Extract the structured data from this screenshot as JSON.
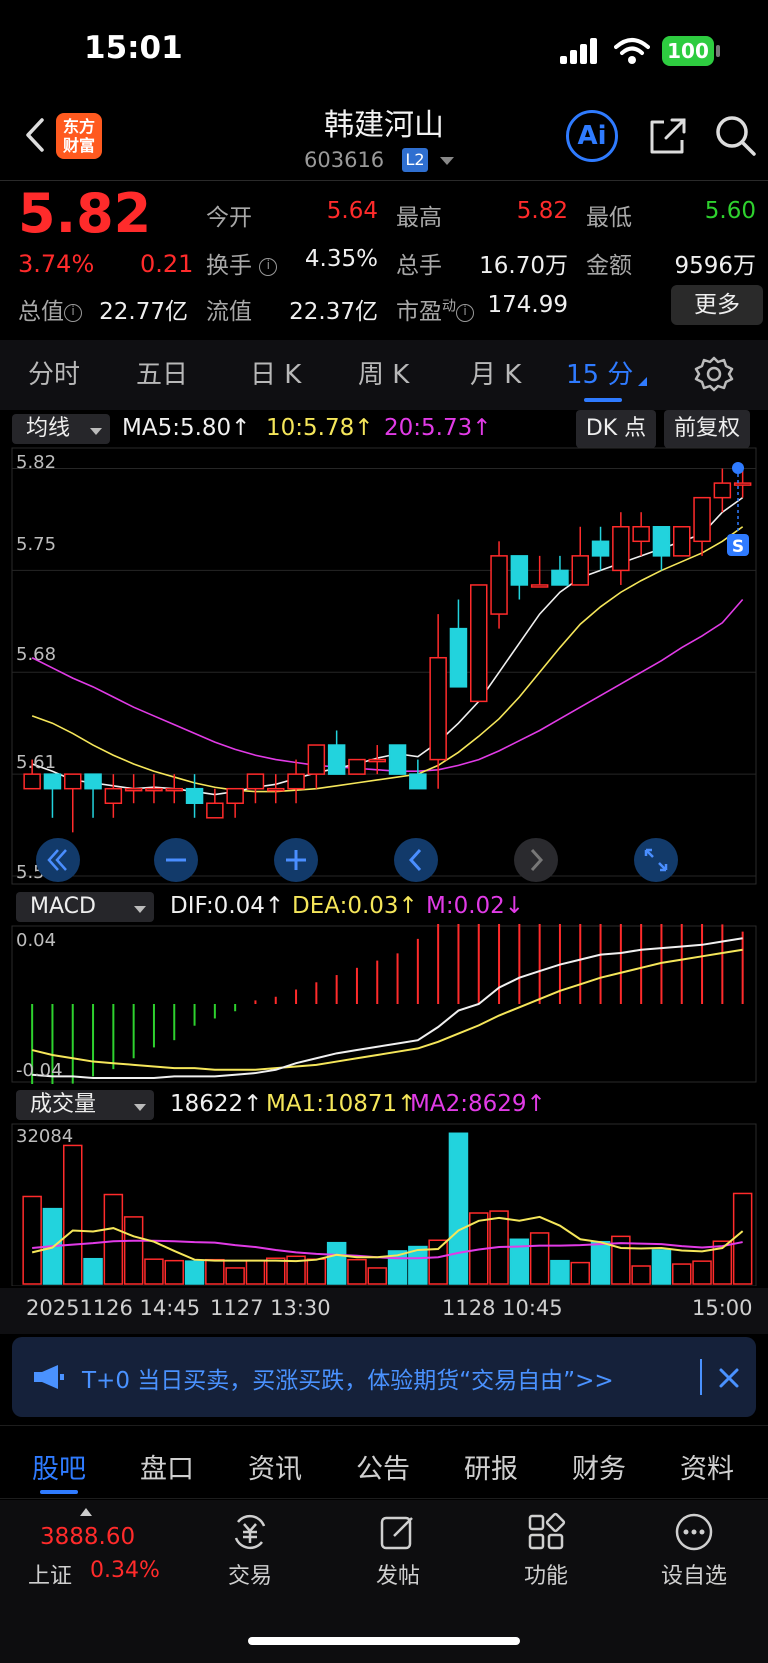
{
  "status_bar": {
    "time": "15:01",
    "battery": "100"
  },
  "header": {
    "logo_text": "东方财富",
    "stock_name": "韩建河山",
    "stock_code": "603616",
    "level_badge": "L2"
  },
  "quote": {
    "price": "5.82",
    "change_pct": "3.74%",
    "change_amt": "0.21",
    "open_label": "今开",
    "open": "5.64",
    "high_label": "最高",
    "high": "5.82",
    "low_label": "最低",
    "low": "5.60",
    "turnover_label": "换手",
    "turnover": "4.35%",
    "volume_label": "总手",
    "volume": "16.70万",
    "amount_label": "金额",
    "amount": "9596万",
    "mktcap_label": "总值",
    "mktcap": "22.77亿",
    "float_label": "流值",
    "float_cap": "22.37亿",
    "pe_label": "市盈",
    "pe_sup": "动",
    "pe": "174.99",
    "more_button": "更多"
  },
  "period_tabs": [
    "分时",
    "五日",
    "日 K",
    "周 K",
    "月 K",
    "15 分"
  ],
  "active_period": "15 分",
  "colors": {
    "up": "#ff2b2b",
    "down": "#22d3dd",
    "accent": "#2f7bff",
    "ma5": "#f0f0f0",
    "ma10": "#f5e65a",
    "ma20": "#e13be6"
  },
  "kline_panel": {
    "indicator_select": "均线",
    "ma5": "MA5:5.80↑",
    "ma10": "10:5.78↑",
    "ma20": "20:5.73↑",
    "dk_button": "DK 点",
    "adjust_button": "前复权",
    "y_labels": [
      "5.82",
      "5.75",
      "5.68",
      "5.61",
      "5.54"
    ],
    "signal_marker": "S"
  },
  "chart_data": [
    {
      "type": "candlestick",
      "title": "15 分",
      "ylim": [
        5.54,
        5.83
      ],
      "y_ticks": [
        5.82,
        5.75,
        5.68,
        5.61,
        5.54
      ],
      "candles": [
        {
          "o": 5.6,
          "h": 5.62,
          "l": 5.6,
          "c": 5.61
        },
        {
          "o": 5.61,
          "h": 5.61,
          "l": 5.58,
          "c": 5.6
        },
        {
          "o": 5.6,
          "h": 5.61,
          "l": 5.57,
          "c": 5.61
        },
        {
          "o": 5.61,
          "h": 5.61,
          "l": 5.58,
          "c": 5.6
        },
        {
          "o": 5.59,
          "h": 5.61,
          "l": 5.58,
          "c": 5.6
        },
        {
          "o": 5.6,
          "h": 5.61,
          "l": 5.59,
          "c": 5.6
        },
        {
          "o": 5.6,
          "h": 5.61,
          "l": 5.59,
          "c": 5.6
        },
        {
          "o": 5.6,
          "h": 5.61,
          "l": 5.59,
          "c": 5.6
        },
        {
          "o": 5.6,
          "h": 5.61,
          "l": 5.58,
          "c": 5.59
        },
        {
          "o": 5.58,
          "h": 5.6,
          "l": 5.58,
          "c": 5.59
        },
        {
          "o": 5.59,
          "h": 5.6,
          "l": 5.58,
          "c": 5.6
        },
        {
          "o": 5.6,
          "h": 5.61,
          "l": 5.59,
          "c": 5.61
        },
        {
          "o": 5.6,
          "h": 5.61,
          "l": 5.59,
          "c": 5.6
        },
        {
          "o": 5.6,
          "h": 5.62,
          "l": 5.59,
          "c": 5.61
        },
        {
          "o": 5.61,
          "h": 5.63,
          "l": 5.6,
          "c": 5.63
        },
        {
          "o": 5.63,
          "h": 5.64,
          "l": 5.61,
          "c": 5.61
        },
        {
          "o": 5.61,
          "h": 5.62,
          "l": 5.61,
          "c": 5.62
        },
        {
          "o": 5.62,
          "h": 5.63,
          "l": 5.61,
          "c": 5.62
        },
        {
          "o": 5.63,
          "h": 5.63,
          "l": 5.61,
          "c": 5.61
        },
        {
          "o": 5.61,
          "h": 5.62,
          "l": 5.6,
          "c": 5.6
        },
        {
          "o": 5.62,
          "h": 5.72,
          "l": 5.6,
          "c": 5.69
        },
        {
          "o": 5.71,
          "h": 5.73,
          "l": 5.67,
          "c": 5.67
        },
        {
          "o": 5.66,
          "h": 5.74,
          "l": 5.66,
          "c": 5.74
        },
        {
          "o": 5.72,
          "h": 5.77,
          "l": 5.71,
          "c": 5.76
        },
        {
          "o": 5.76,
          "h": 5.76,
          "l": 5.73,
          "c": 5.74
        },
        {
          "o": 5.74,
          "h": 5.76,
          "l": 5.74,
          "c": 5.74
        },
        {
          "o": 5.75,
          "h": 5.76,
          "l": 5.74,
          "c": 5.74
        },
        {
          "o": 5.74,
          "h": 5.78,
          "l": 5.74,
          "c": 5.76
        },
        {
          "o": 5.77,
          "h": 5.78,
          "l": 5.75,
          "c": 5.76
        },
        {
          "o": 5.75,
          "h": 5.79,
          "l": 5.74,
          "c": 5.78
        },
        {
          "o": 5.77,
          "h": 5.79,
          "l": 5.76,
          "c": 5.78
        },
        {
          "o": 5.78,
          "h": 5.78,
          "l": 5.75,
          "c": 5.76
        },
        {
          "o": 5.76,
          "h": 5.78,
          "l": 5.76,
          "c": 5.78
        },
        {
          "o": 5.77,
          "h": 5.8,
          "l": 5.76,
          "c": 5.8
        },
        {
          "o": 5.8,
          "h": 5.82,
          "l": 5.79,
          "c": 5.81
        },
        {
          "o": 5.81,
          "h": 5.82,
          "l": 5.8,
          "c": 5.81
        }
      ],
      "ma5": [
        5.617,
        5.612,
        5.606,
        5.604,
        5.602,
        5.6,
        5.601,
        5.6,
        5.598,
        5.596,
        5.598,
        5.601,
        5.603,
        5.607,
        5.611,
        5.614,
        5.617,
        5.621,
        5.624,
        5.622,
        5.632,
        5.645,
        5.66,
        5.68,
        5.7,
        5.72,
        5.735,
        5.745,
        5.75,
        5.755,
        5.76,
        5.765,
        5.77,
        5.775,
        5.79,
        5.8
      ],
      "ma10": [
        5.65,
        5.645,
        5.638,
        5.63,
        5.623,
        5.617,
        5.612,
        5.608,
        5.604,
        5.601,
        5.599,
        5.598,
        5.598,
        5.599,
        5.6,
        5.602,
        5.604,
        5.606,
        5.608,
        5.61,
        5.616,
        5.625,
        5.636,
        5.648,
        5.663,
        5.68,
        5.697,
        5.713,
        5.725,
        5.735,
        5.743,
        5.75,
        5.756,
        5.762,
        5.77,
        5.78
      ],
      "ma20": [
        5.69,
        5.683,
        5.676,
        5.67,
        5.663,
        5.656,
        5.65,
        5.644,
        5.638,
        5.632,
        5.627,
        5.623,
        5.62,
        5.618,
        5.616,
        5.615,
        5.614,
        5.613,
        5.612,
        5.612,
        5.613,
        5.616,
        5.62,
        5.626,
        5.633,
        5.64,
        5.648,
        5.656,
        5.664,
        5.672,
        5.68,
        5.688,
        5.697,
        5.705,
        5.714,
        5.73
      ]
    },
    {
      "type": "bar",
      "title": "MACD",
      "ylim": [
        -0.045,
        0.045
      ],
      "y_ticks": [
        0.04,
        -0.04
      ],
      "m": [
        -0.03,
        -0.026,
        -0.022,
        -0.02,
        -0.018,
        -0.015,
        -0.012,
        -0.01,
        -0.006,
        -0.004,
        -0.002,
        0.001,
        0.002,
        0.004,
        0.006,
        0.008,
        0.01,
        0.012,
        0.014,
        0.018,
        0.024,
        0.028,
        0.03,
        0.032,
        0.034,
        0.034,
        0.033,
        0.032,
        0.031,
        0.03,
        0.028,
        0.027,
        0.026,
        0.024,
        0.022,
        0.02
      ],
      "dif": [
        -0.043,
        -0.044,
        -0.044,
        -0.045,
        -0.045,
        -0.045,
        -0.045,
        -0.044,
        -0.044,
        -0.044,
        -0.043,
        -0.042,
        -0.04,
        -0.036,
        -0.033,
        -0.03,
        -0.028,
        -0.026,
        -0.024,
        -0.022,
        -0.014,
        -0.004,
        0.0,
        0.01,
        0.016,
        0.02,
        0.024,
        0.027,
        0.03,
        0.031,
        0.033,
        0.034,
        0.035,
        0.036,
        0.038,
        0.04
      ],
      "dea": [
        -0.028,
        -0.031,
        -0.033,
        -0.035,
        -0.036,
        -0.037,
        -0.038,
        -0.039,
        -0.039,
        -0.04,
        -0.04,
        -0.04,
        -0.039,
        -0.038,
        -0.037,
        -0.035,
        -0.033,
        -0.031,
        -0.029,
        -0.027,
        -0.023,
        -0.018,
        -0.013,
        -0.007,
        -0.002,
        0.003,
        0.008,
        0.012,
        0.016,
        0.019,
        0.022,
        0.025,
        0.027,
        0.029,
        0.031,
        0.033
      ]
    },
    {
      "type": "bar",
      "title": "成交量",
      "ylim": [
        0,
        32084
      ],
      "y_ticks": [
        32084
      ],
      "volume": [
        18000,
        15500,
        28500,
        5200,
        18400,
        13800,
        5100,
        4800,
        4700,
        5000,
        3300,
        4800,
        5300,
        5700,
        5100,
        8500,
        5000,
        3300,
        6800,
        7700,
        9000,
        31000,
        14600,
        15000,
        9200,
        10500,
        4800,
        4400,
        8700,
        9800,
        3700,
        7000,
        4100,
        4700,
        8800,
        18622
      ],
      "ma1": [
        6500,
        7500,
        11000,
        10800,
        11500,
        9800,
        8700,
        6800,
        5000,
        4800,
        4800,
        4800,
        4800,
        4700,
        5000,
        6000,
        5500,
        5500,
        5900,
        7000,
        7200,
        11000,
        13000,
        13600,
        13000,
        13800,
        12000,
        9200,
        8600,
        7400,
        7300,
        7400,
        6900,
        6700,
        7400,
        10871
      ],
      "ma2": [
        7400,
        7800,
        8100,
        8400,
        8800,
        8900,
        8900,
        8800,
        8600,
        8500,
        8000,
        7600,
        7000,
        6500,
        6200,
        6000,
        5800,
        5500,
        5300,
        5300,
        5500,
        6400,
        7100,
        7600,
        7700,
        7900,
        7900,
        8000,
        8200,
        8400,
        8300,
        8200,
        7800,
        7500,
        7800,
        8629
      ]
    }
  ],
  "macd_panel": {
    "indicator_select": "MACD",
    "dif": "DIF:0.04↑",
    "dea": "DEA:0.03↑",
    "m": "M:0.02↓",
    "y_top": "0.04",
    "y_bottom": "-0.04"
  },
  "volume_panel": {
    "indicator_select": "成交量",
    "vol": "18622↑",
    "ma1": "MA1:10871↑",
    "ma2": "MA2:8629↑",
    "y_top": "32084"
  },
  "time_axis": [
    "20251126 14:45",
    "1127 13:30",
    "1128 10:45",
    "15:00"
  ],
  "banner": {
    "text": "T+0 当日买卖，买涨买跌，体验期货“交易自由”>>"
  },
  "bottom_tabs": [
    "股吧",
    "盘口",
    "资讯",
    "公告",
    "研报",
    "财务",
    "资料"
  ],
  "active_bottom_tab": "股吧",
  "bottom_nav": {
    "index_value": "3888.60",
    "index_name": "上证",
    "index_pct": "0.34%",
    "items": [
      "交易",
      "发帖",
      "功能",
      "设自选"
    ]
  }
}
